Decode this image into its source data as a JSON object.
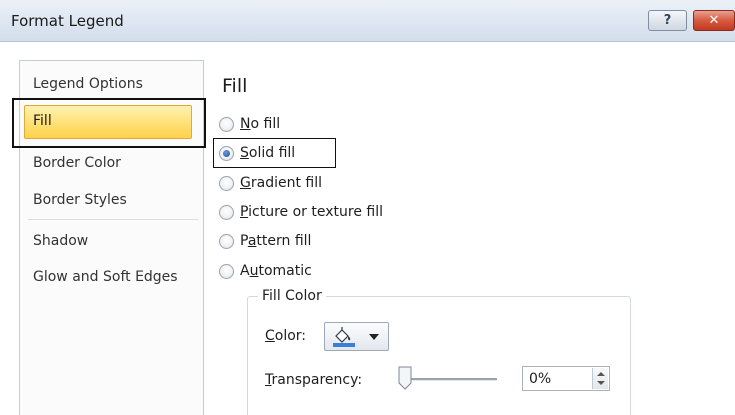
{
  "dialog": {
    "title": "Format Legend",
    "help_glyph": "?",
    "close_glyph": "✕"
  },
  "nav": {
    "items": [
      {
        "label": "Legend Options",
        "selected": false
      },
      {
        "label": "Fill",
        "selected": true
      },
      {
        "label": "Border Color",
        "selected": false
      },
      {
        "label": "Border Styles",
        "selected": false
      },
      {
        "label": "Shadow",
        "selected": false
      },
      {
        "label": "Glow and Soft Edges",
        "selected": false
      }
    ]
  },
  "fill": {
    "heading": "Fill",
    "options": [
      {
        "accel": "N",
        "rest": "o fill",
        "checked": false
      },
      {
        "accel": "S",
        "rest": "olid fill",
        "checked": true
      },
      {
        "accel": "G",
        "rest": "radient fill",
        "checked": false
      },
      {
        "accel": "P",
        "rest": "icture or texture fill",
        "checked": false
      },
      {
        "pre": "P",
        "accel": "a",
        "rest": "ttern fill",
        "checked": false
      },
      {
        "pre": "A",
        "accel": "u",
        "rest": "tomatic",
        "checked": false
      }
    ],
    "group": {
      "legend": "Fill Color",
      "color_label_accel": "C",
      "color_label_rest": "olor:",
      "color_icon": "paint-bucket-icon",
      "fill_swatch": "#3b7fd6",
      "transparency_label_accel": "T",
      "transparency_label_rest": "ransparency:",
      "transparency_value": "0%",
      "transparency_level": 0
    }
  },
  "colors": {
    "selected_nav": "#ffe27a",
    "close_button": "#d85c43",
    "annotation_border": "#111111"
  }
}
